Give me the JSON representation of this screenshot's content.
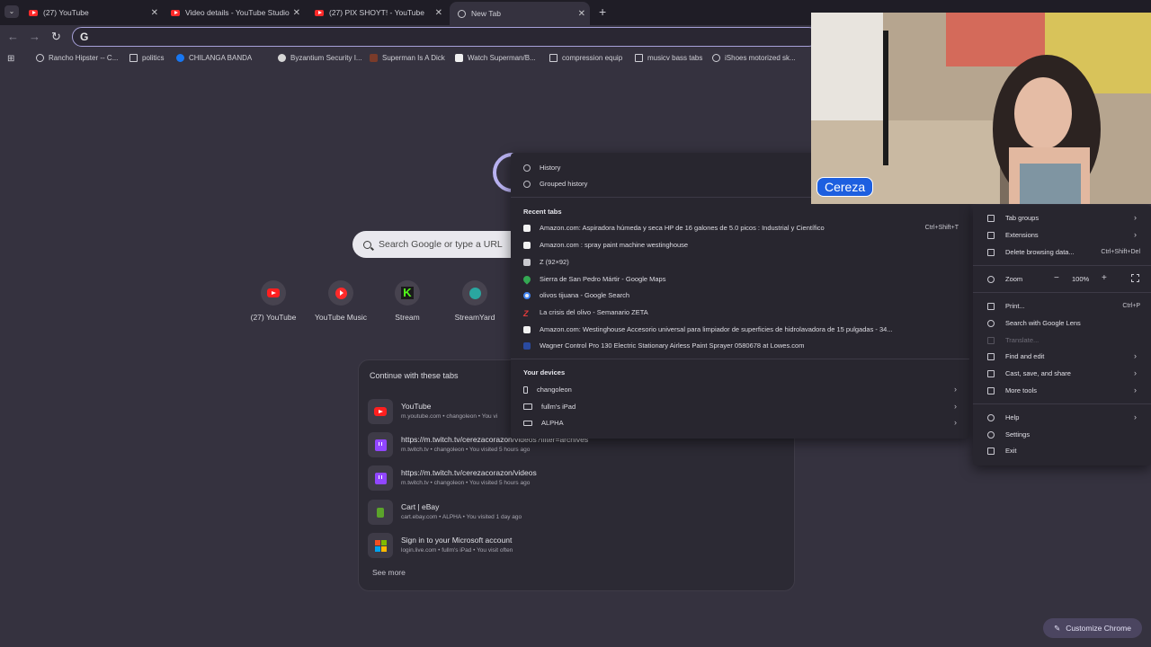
{
  "tabs": [
    {
      "title": "(27) YouTube",
      "icon": "youtube-icon"
    },
    {
      "title": "Video details - YouTube Studio",
      "icon": "youtube-icon"
    },
    {
      "title": "(27) PIX SHOYT! - YouTube",
      "icon": "youtube-icon"
    },
    {
      "title": "New Tab",
      "icon": "globe-icon",
      "active": true
    }
  ],
  "omnibox": {
    "value": "",
    "engine_glyph": "G"
  },
  "bookmarks": [
    {
      "label": "Rancho Hipster -- C...",
      "icon": "globe"
    },
    {
      "label": "politics",
      "icon": "folder"
    },
    {
      "label": "CHILANGA BANDA",
      "icon": "facebook"
    },
    {
      "label": "Byzantium Security I...",
      "icon": "wordpress"
    },
    {
      "label": "Superman Is A Dick",
      "icon": "image"
    },
    {
      "label": "Watch Superman/B...",
      "icon": "page"
    },
    {
      "label": "compression equip",
      "icon": "folder"
    },
    {
      "label": "musicv bass tabs",
      "icon": "folder"
    },
    {
      "label": "iShoes motorized sk...",
      "icon": "globe"
    }
  ],
  "search": {
    "placeholder": "Search Google or type a URL"
  },
  "shortcuts": [
    {
      "label": "(27) YouTube"
    },
    {
      "label": "YouTube Music"
    },
    {
      "label": "Stream"
    },
    {
      "label": "StreamYard"
    }
  ],
  "continue": {
    "title": "Continue with these tabs",
    "items": [
      {
        "title": "YouTube",
        "sub": "m.youtube.com • changoleon • You vi"
      },
      {
        "title": "https://m.twitch.tv/cerezacorazon/videos?filter=archives",
        "sub": "m.twitch.tv • changoleon • You visited 5 hours ago"
      },
      {
        "title": "https://m.twitch.tv/cerezacorazon/videos",
        "sub": "m.twitch.tv • changoleon • You visited 5 hours ago"
      },
      {
        "title": "Cart | eBay",
        "sub": "cart.ebay.com • ALPHA • You visited 1 day ago"
      },
      {
        "title": "Sign in to your Microsoft account",
        "sub": "login.live.com • fullm's iPad • You visit often"
      }
    ],
    "see_more": "See more"
  },
  "history_menu": {
    "history": "History",
    "grouped": "Grouped history",
    "recent_title": "Recent tabs",
    "recent_shortcut": "Ctrl+Shift+T",
    "recent": [
      "Amazon.com: Aspiradora húmeda y seca HP de 16 galones de 5.0 picos : Industrial y Científico",
      "Amazon.com : spray paint machine westinghouse",
      "Z (92×92)",
      "Sierra de San Pedro Mártir - Google Maps",
      "olivos tijuana - Google Search",
      "La crisis del olivo - Semanario ZETA",
      "Amazon.com: Westinghouse Accesorio universal para limpiador de superficies de hidrolavadora de 15 pulgadas - 34...",
      "Wagner Control Pro 130 Electric Stationary Airless Paint Sprayer 0580678 at Lowes.com"
    ],
    "devices_title": "Your devices",
    "devices": [
      "changoleon",
      "fullm's iPad",
      "ALPHA"
    ]
  },
  "main_menu": {
    "tab_groups": "Tab groups",
    "extensions": "Extensions",
    "delete": "Delete browsing data...",
    "delete_sc": "Ctrl+Shift+Del",
    "zoom": "Zoom",
    "zoom_minus": "−",
    "zoom_value": "100%",
    "zoom_plus": "+",
    "print": "Print...",
    "print_sc": "Ctrl+P",
    "lens": "Search with Google Lens",
    "translate": "Translate...",
    "find": "Find and edit",
    "cast": "Cast, save, and share",
    "more_tools": "More tools",
    "help": "Help",
    "settings": "Settings",
    "exit": "Exit"
  },
  "webcam": {
    "name": "Cereza"
  },
  "customize": "Customize Chrome",
  "colors": {
    "accent": "#b9b2f1",
    "background": "#35323f",
    "menu": "#28262f"
  }
}
